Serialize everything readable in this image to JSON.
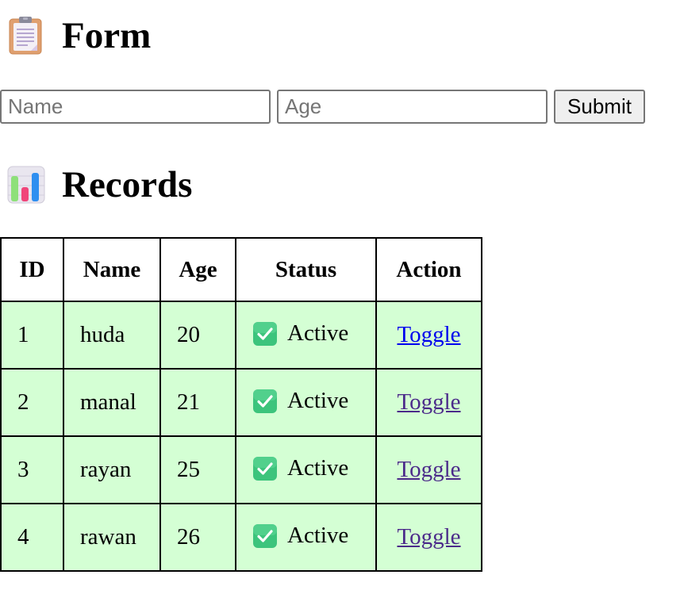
{
  "form_section": {
    "title": "Form",
    "icon": "clipboard-icon"
  },
  "form": {
    "name_placeholder": "Name",
    "name_value": "",
    "age_placeholder": "Age",
    "age_value": "",
    "submit_label": "Submit"
  },
  "records_section": {
    "title": "Records",
    "icon": "bar-chart-icon"
  },
  "table": {
    "headers": [
      "ID",
      "Name",
      "Age",
      "Status",
      "Action"
    ],
    "rows": [
      {
        "id": "1",
        "name": "huda",
        "age": "20",
        "status": "Active",
        "status_icon": "check-mark-button-icon",
        "action": "Toggle"
      },
      {
        "id": "2",
        "name": "manal",
        "age": "21",
        "status": "Active",
        "status_icon": "check-mark-button-icon",
        "action": "Toggle"
      },
      {
        "id": "3",
        "name": "rayan",
        "age": "25",
        "status": "Active",
        "status_icon": "check-mark-button-icon",
        "action": "Toggle"
      },
      {
        "id": "4",
        "name": "rawan",
        "age": "26",
        "status": "Active",
        "status_icon": "check-mark-button-icon",
        "action": "Toggle"
      }
    ]
  },
  "colors": {
    "row_background": "#d4ffd4",
    "link_unvisited": "#0000ee",
    "link_visited": "#4b2a8a",
    "check_green": "#3cc47c"
  }
}
